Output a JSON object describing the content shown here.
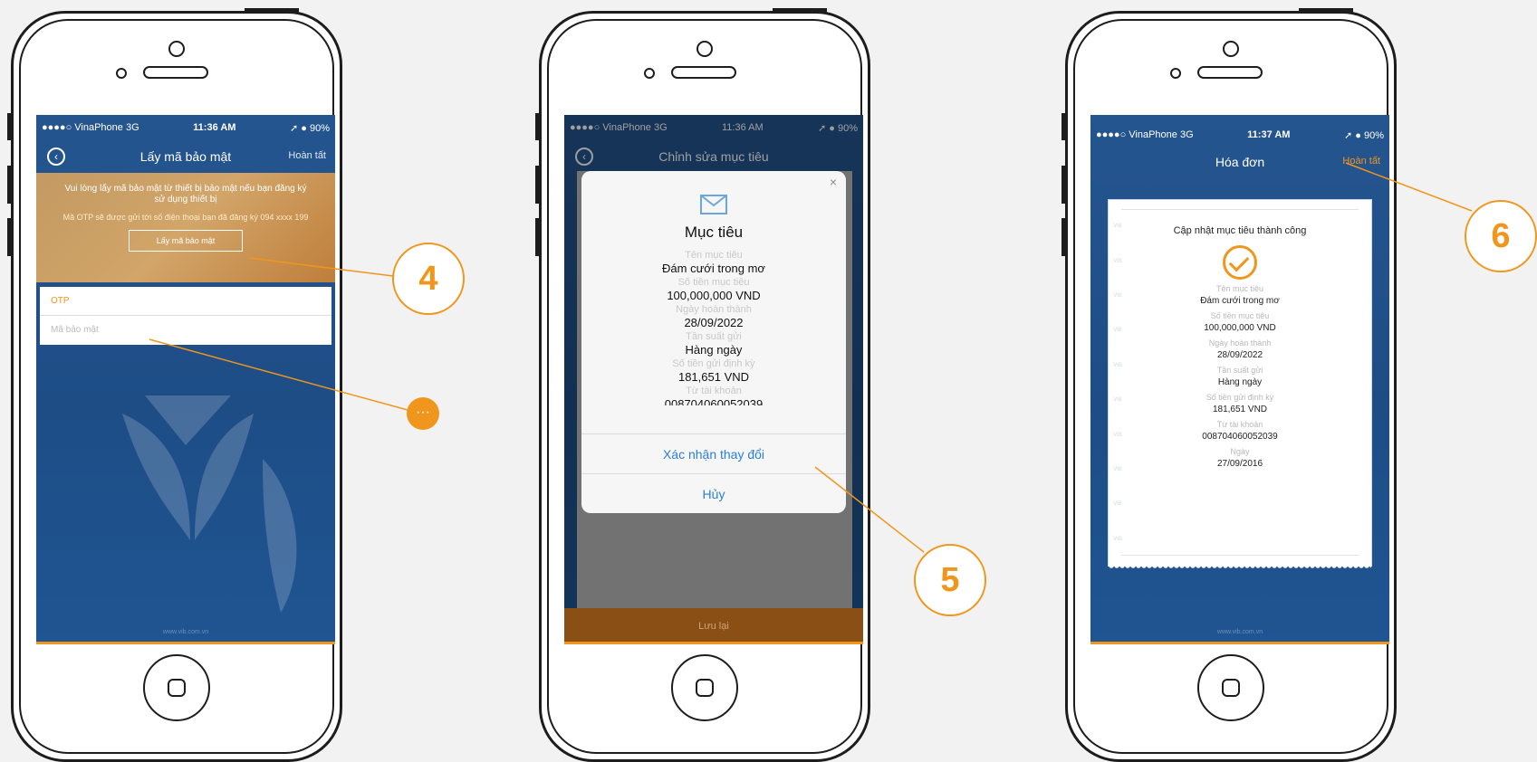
{
  "phone1": {
    "status": {
      "carrier": "●●●●○ VinaPhone  3G",
      "time": "11:36 AM",
      "battery": "➚ ● 90%"
    },
    "nav": {
      "title": "Lấy mã bảo mật",
      "done": "Hoàn tất"
    },
    "banner": {
      "line1": "Vui lòng lấy mã bảo mật từ thiết bị bảo mật nếu bạn đăng ký sử dụng thiết bị",
      "line2": "Mã OTP sẽ được gửi tới số điện thoại bạn đã đăng ký 094 xxxx 199",
      "button": "Lấy mã bảo mật"
    },
    "otp_field": "OTP",
    "code_placeholder": "Mã bảo mật",
    "footer": "www.vib.com.vn"
  },
  "phone2": {
    "status": {
      "carrier": "●●●●○ VinaPhone  3G",
      "time": "11:36 AM",
      "battery": "➚ ● 90%"
    },
    "nav": {
      "title": "Chỉnh sửa mục tiêu"
    },
    "dialog": {
      "close": "×",
      "title": "Mục tiêu",
      "rows": [
        {
          "label": "Tên mục tiêu",
          "value": "Đám cưới trong mơ"
        },
        {
          "label": "Số tiền mục tiêu",
          "value": "100,000,000 VND"
        },
        {
          "label": "Ngày hoàn thành",
          "value": "28/09/2022"
        },
        {
          "label": "Tần suất gửi",
          "value": "Hàng ngày"
        },
        {
          "label": "Số tiền gửi định kỳ",
          "value": "181,651 VND"
        },
        {
          "label": "Từ tài khoản",
          "value": "008704060052039"
        }
      ],
      "confirm": "Xác nhận thay đổi",
      "cancel": "Hủy"
    },
    "save_button": "Lưu lại"
  },
  "phone3": {
    "status": {
      "carrier": "●●●●○ VinaPhone  3G",
      "time": "11:37 AM",
      "battery": "➚ ● 90%"
    },
    "nav": {
      "title": "Hóa đơn",
      "done": "Hoàn tất"
    },
    "receipt": {
      "title": "Cập nhật mục tiêu thành công",
      "rows": [
        {
          "label": "Tên mục tiêu",
          "value": "Đám cưới trong mơ"
        },
        {
          "label": "Số tiền mục tiêu",
          "value": "100,000,000 VND"
        },
        {
          "label": "Ngày hoàn thành",
          "value": "28/09/2022"
        },
        {
          "label": "Tần suất gửi",
          "value": "Hàng ngày"
        },
        {
          "label": "Số tiền gửi định kỳ",
          "value": "181,651 VND"
        },
        {
          "label": "Từ tài khoản",
          "value": "008704060052039"
        },
        {
          "label": "Ngày",
          "value": "27/09/2016"
        }
      ],
      "watermark": "VIB"
    },
    "footer": "www.vib.com.vn"
  },
  "callouts": {
    "c4": "4",
    "c5": "5",
    "c6": "6",
    "dot": "···"
  },
  "colors": {
    "accent": "#f0961c",
    "screen_blue": "#25558f",
    "link_blue": "#2b7fd6"
  }
}
